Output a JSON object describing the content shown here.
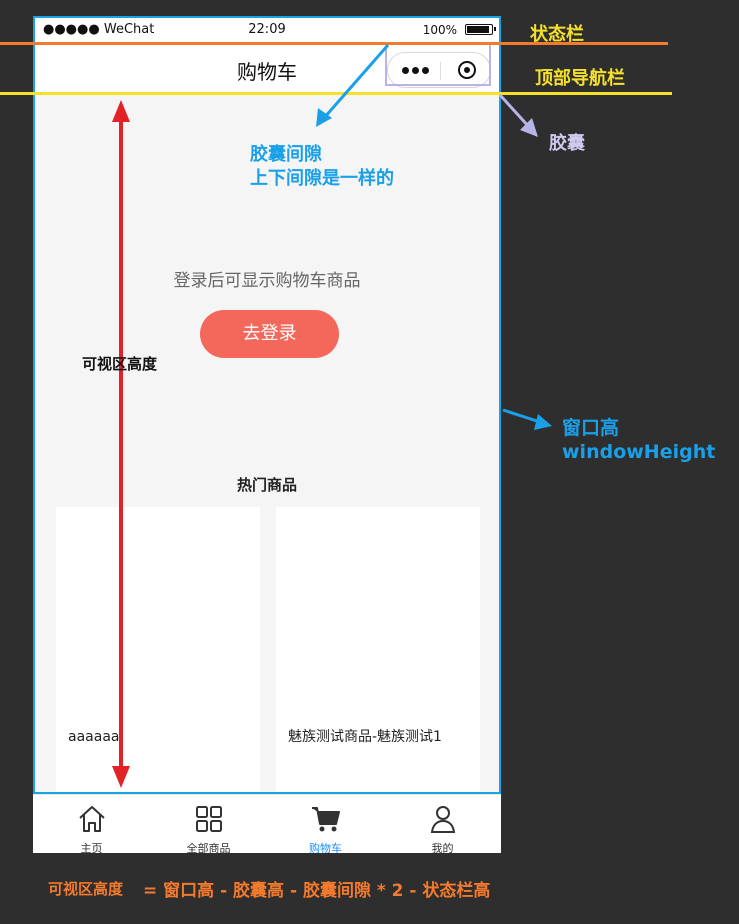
{
  "status_bar": {
    "carrier": "●●●●● WeChat",
    "time": "22:09",
    "battery": "100%"
  },
  "nav_bar": {
    "title": "购物车"
  },
  "cart": {
    "login_hint": "登录后可显示购物车商品",
    "login_button": "去登录"
  },
  "hot": {
    "title": "热门商品",
    "products": [
      {
        "name": "aaaaaa"
      },
      {
        "name": "魅族测试商品-魅族测试1"
      }
    ]
  },
  "tab_bar": {
    "items": [
      {
        "label": "主页",
        "icon": "home-icon",
        "active": false
      },
      {
        "label": "全部商品",
        "icon": "grid-icon",
        "active": false
      },
      {
        "label": "购物车",
        "icon": "cart-icon",
        "active": true
      },
      {
        "label": "我的",
        "icon": "user-icon",
        "active": false
      }
    ]
  },
  "annotations": {
    "status_bar": "状态栏",
    "top_nav": "顶部导航栏",
    "capsule": "胶囊",
    "capsule_gap_line1": "胶囊间隙",
    "capsule_gap_line2": "上下间隙是一样的",
    "visible_height": "可视区高度",
    "window_height_line1": "窗口高",
    "window_height_line2": "windowHeight",
    "formula_label": "可视区高度",
    "formula": "= 窗口高 - 胶囊高 - 胶囊间隙 * 2 - 状态栏高"
  },
  "colors": {
    "accent_blue": "#1aa0e8",
    "tab_active": "#1a8cff",
    "login_button": "#f4675b",
    "status_line": "#f47a2d",
    "nav_line": "#f5e02a",
    "arrow_red": "#e32228",
    "capsule_frame": "#b9b4e8"
  }
}
